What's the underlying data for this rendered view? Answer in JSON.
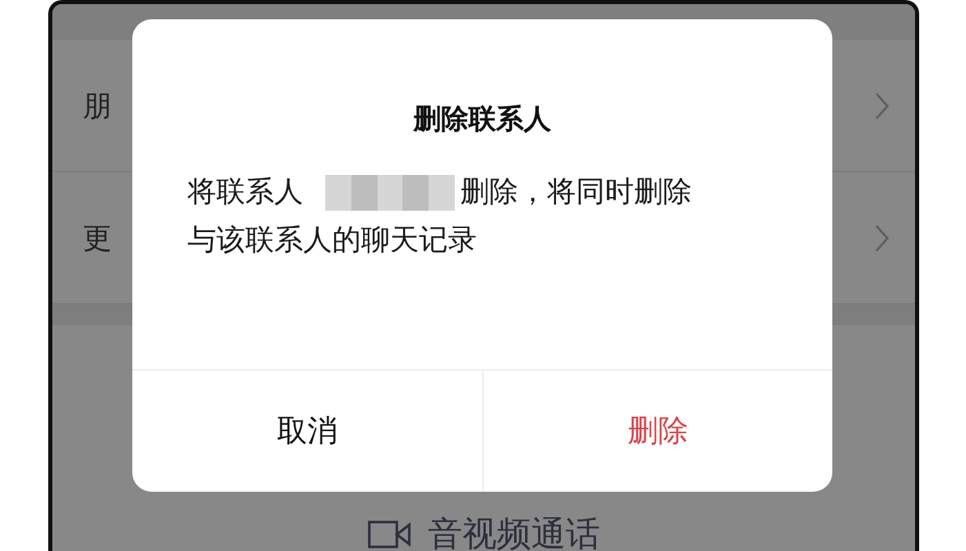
{
  "settings_rows": [
    {
      "label": "朋"
    },
    {
      "label": "更"
    }
  ],
  "call_button": {
    "label": "音视频通话"
  },
  "dialog": {
    "title": "删除联系人",
    "message": {
      "before": "将联系人",
      "after": "删除，将同时删除",
      "line_2": "与该联系人的聊天记录"
    },
    "buttons": [
      {
        "label": "取消",
        "kind": "cancel"
      },
      {
        "label": "删除",
        "kind": "destructive"
      }
    ]
  }
}
